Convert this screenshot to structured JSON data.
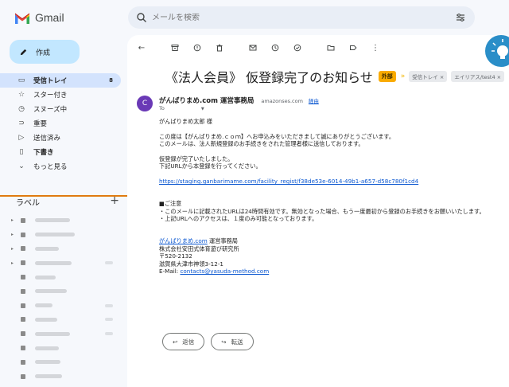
{
  "app": {
    "name": "Gmail"
  },
  "search": {
    "placeholder": "メールを検索"
  },
  "compose": {
    "label": "作成"
  },
  "nav": [
    {
      "icon": "inbox-icon",
      "glyph": "▭",
      "label": "受信トレイ",
      "count": "8",
      "active": true
    },
    {
      "icon": "star-icon",
      "glyph": "☆",
      "label": "スター付き"
    },
    {
      "icon": "clock-icon",
      "glyph": "◷",
      "label": "スヌーズ中"
    },
    {
      "icon": "important-icon",
      "glyph": "⊃",
      "label": "重要"
    },
    {
      "icon": "send-icon",
      "glyph": "▷",
      "label": "送信済み"
    },
    {
      "icon": "draft-icon",
      "glyph": "▯",
      "label": "下書き",
      "bold": true
    },
    {
      "icon": "chevron-down-icon",
      "glyph": "⌄",
      "label": "もっと見る"
    }
  ],
  "labels": {
    "heading": "ラベル",
    "add": "+"
  },
  "email": {
    "subject": "《法人会員》 仮登録完了のお知らせ",
    "badge": "外部",
    "chips": [
      "受信トレイ ×",
      "エイリアス/test4 ×"
    ],
    "avatar_letter": "C",
    "sender_name": "がんばりまめ.com 運営事務局",
    "sender_email": "amazonses.com",
    "unsubscribe": "経由",
    "to": "To",
    "body": {
      "greeting": "がんばりまめ太郎 様",
      "p1_line1": "この度は【がんばりまめ.ｃｏｍ】へお申込みをいただきまして誠にありがとうございます。",
      "p1_line2": "このメールは、法人新規登録のお手続きをされた管理者様に送信しております。",
      "p2_line1": "仮登録が完了いたしました。",
      "p2_line2": "下記URLから本登録を行ってください。",
      "url": "https://staging.ganbarimame.com/facility_regist/f38de53e-6014-49b1-a657-d58c780f1cd4",
      "note_head": "■ご注意",
      "note1": "・このメールに記載されたURLは24時間有効です。無効となった場合、もう一度最初から登録のお手続きをお願いいたします。",
      "note2": "・上記URLへのアクセスは、１度のみ可能となっております。",
      "sig_link": "がんばりまめ.com",
      "sig_link_rest": " 運営事務局",
      "sig_company": "株式会社安田式体育遊び研究所",
      "sig_zip": "〒520-2132",
      "sig_addr": "滋賀県大津市神領3-12-1",
      "sig_mail_label": "E-Mail: ",
      "sig_mail": "contacts@yasuda-method.com"
    },
    "reply_label": "返信",
    "forward_label": "転送"
  },
  "colors": {
    "accent": "#0b57d0",
    "pointer": "#e07b10",
    "badge": "#f9ab00"
  }
}
